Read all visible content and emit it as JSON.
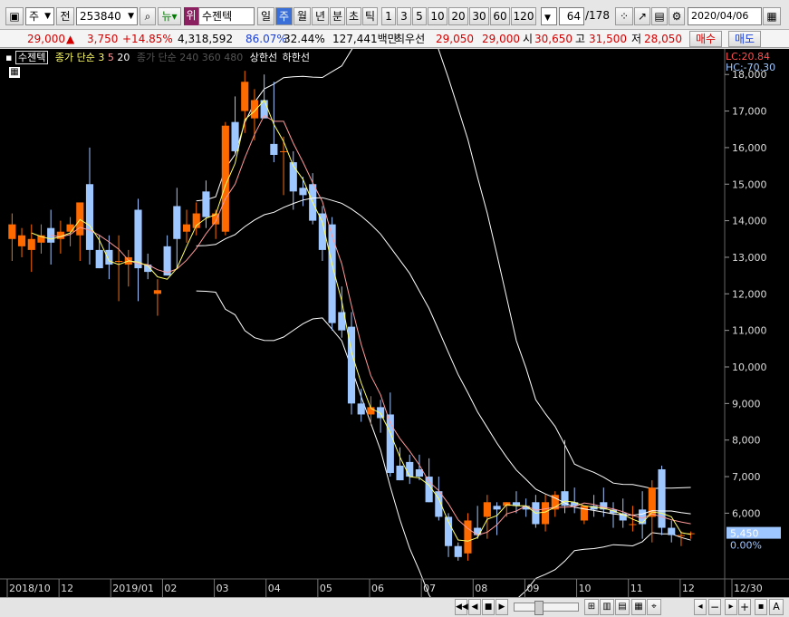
{
  "toolbar": {
    "period_label": "주",
    "jeon_label": "전",
    "code": "253840",
    "news_label": "뉴",
    "wi_label": "위",
    "stock_name": "수젠텍",
    "period_tabs": [
      "일",
      "주",
      "월",
      "년"
    ],
    "active_tab": "주",
    "time_units": [
      "분",
      "초",
      "틱"
    ],
    "intervals": [
      "1",
      "3",
      "5",
      "10",
      "20",
      "30",
      "60",
      "120"
    ],
    "page_current": "64",
    "page_total": "/178",
    "date": "2020/04/06"
  },
  "quote": {
    "price": "29,000",
    "change_arrow": "▲",
    "change": "3,750",
    "change_pct": "+14.85%",
    "volume": "4,318,592",
    "ratio1": "86.07%",
    "ratio2": "32.44%",
    "amount": "127,441백만",
    "best_ask_label": "최우선",
    "best_ask": "29,050",
    "best_bid": "29,000",
    "open_label": "시",
    "open": "30,650",
    "high_label": "고",
    "high": "31,500",
    "low_label": "저",
    "low": "28,050",
    "buy_label": "매수",
    "sell_label": "매도"
  },
  "chart_header": {
    "name": "수젠텍",
    "ma_label": "종가 단순",
    "ma_periods": [
      "3",
      "5",
      "20"
    ],
    "extra": "종가 단순 240 360 480",
    "upper_limit_label": "상한선",
    "lower_limit_label": "하한선",
    "lc_label": "LC:20.84",
    "hc_label": "HC:-70.30"
  },
  "chart_data": {
    "type": "candlestick",
    "y_range": [
      4300,
      18600
    ],
    "y_ticks": [
      "18,000",
      "17,000",
      "16,000",
      "15,000",
      "14,000",
      "13,000",
      "12,000",
      "11,000",
      "10,000",
      "9,000",
      "8,000",
      "7,000",
      "6,000"
    ],
    "last_price_label": "5,450",
    "last_pct_label": "0.00%",
    "x_labels": [
      "2018/10",
      "12",
      "2019/01",
      "02",
      "03",
      "04",
      "05",
      "06",
      "07",
      "08",
      "09",
      "10",
      "11",
      "12",
      "12/30"
    ],
    "candles": [
      {
        "o": 13500,
        "h": 14200,
        "l": 12900,
        "c": 13900
      },
      {
        "o": 13300,
        "h": 13800,
        "l": 13000,
        "c": 13600
      },
      {
        "o": 13200,
        "h": 13900,
        "l": 12600,
        "c": 13500
      },
      {
        "o": 13400,
        "h": 13900,
        "l": 13100,
        "c": 13600
      },
      {
        "o": 13800,
        "h": 14300,
        "l": 12800,
        "c": 13400
      },
      {
        "o": 13500,
        "h": 14000,
        "l": 13100,
        "c": 13700
      },
      {
        "o": 13700,
        "h": 14100,
        "l": 13300,
        "c": 13900
      },
      {
        "o": 13600,
        "h": 14400,
        "l": 12900,
        "c": 14500
      },
      {
        "o": 15000,
        "h": 16000,
        "l": 12800,
        "c": 13200
      },
      {
        "o": 13200,
        "h": 13600,
        "l": 12700,
        "c": 12700
      },
      {
        "o": 13200,
        "h": 13600,
        "l": 12400,
        "c": 12800
      },
      {
        "o": 12900,
        "h": 13600,
        "l": 11800,
        "c": 12900
      },
      {
        "o": 12800,
        "h": 13200,
        "l": 12200,
        "c": 13000
      },
      {
        "o": 14300,
        "h": 14600,
        "l": 11800,
        "c": 12700
      },
      {
        "o": 12800,
        "h": 13100,
        "l": 12400,
        "c": 12600
      },
      {
        "o": 12000,
        "h": 12400,
        "l": 11400,
        "c": 12100
      },
      {
        "o": 13300,
        "h": 13600,
        "l": 12500,
        "c": 12500
      },
      {
        "o": 14400,
        "h": 14900,
        "l": 12700,
        "c": 13500
      },
      {
        "o": 13700,
        "h": 14300,
        "l": 13400,
        "c": 13900
      },
      {
        "o": 13800,
        "h": 14500,
        "l": 13600,
        "c": 14200
      },
      {
        "o": 14800,
        "h": 15100,
        "l": 13800,
        "c": 14100
      },
      {
        "o": 13900,
        "h": 14300,
        "l": 13500,
        "c": 14200
      },
      {
        "o": 13700,
        "h": 16700,
        "l": 13600,
        "c": 16600
      },
      {
        "o": 16700,
        "h": 17400,
        "l": 15800,
        "c": 15900
      },
      {
        "o": 17000,
        "h": 18100,
        "l": 16400,
        "c": 17800
      },
      {
        "o": 16800,
        "h": 17600,
        "l": 16200,
        "c": 17300
      },
      {
        "o": 17300,
        "h": 18000,
        "l": 16800,
        "c": 16800
      },
      {
        "o": 16100,
        "h": 17800,
        "l": 15600,
        "c": 15800
      },
      {
        "o": 15900,
        "h": 16300,
        "l": 14700,
        "c": 15900
      },
      {
        "o": 15600,
        "h": 15900,
        "l": 14300,
        "c": 14800
      },
      {
        "o": 14900,
        "h": 15200,
        "l": 14400,
        "c": 14700
      },
      {
        "o": 15000,
        "h": 15300,
        "l": 13900,
        "c": 14000
      },
      {
        "o": 14200,
        "h": 14400,
        "l": 12900,
        "c": 13200
      },
      {
        "o": 13900,
        "h": 14100,
        "l": 11000,
        "c": 11200
      },
      {
        "o": 11500,
        "h": 12200,
        "l": 10800,
        "c": 11000
      },
      {
        "o": 11100,
        "h": 11500,
        "l": 8700,
        "c": 9000
      },
      {
        "o": 9000,
        "h": 9400,
        "l": 8500,
        "c": 8700
      },
      {
        "o": 8700,
        "h": 9200,
        "l": 8400,
        "c": 8900
      },
      {
        "o": 8900,
        "h": 9100,
        "l": 8200,
        "c": 8600
      },
      {
        "o": 8700,
        "h": 9300,
        "l": 7000,
        "c": 7100
      },
      {
        "o": 7300,
        "h": 7800,
        "l": 6900,
        "c": 6900
      },
      {
        "o": 7400,
        "h": 7600,
        "l": 6800,
        "c": 7000
      },
      {
        "o": 7200,
        "h": 7600,
        "l": 6900,
        "c": 7000
      },
      {
        "o": 7000,
        "h": 7500,
        "l": 6300,
        "c": 6300
      },
      {
        "o": 6600,
        "h": 7000,
        "l": 5800,
        "c": 5900
      },
      {
        "o": 5900,
        "h": 6000,
        "l": 4800,
        "c": 5100
      },
      {
        "o": 5100,
        "h": 5200,
        "l": 4700,
        "c": 4800
      },
      {
        "o": 4900,
        "h": 6000,
        "l": 4700,
        "c": 5800
      },
      {
        "o": 5600,
        "h": 6200,
        "l": 5300,
        "c": 5400
      },
      {
        "o": 5900,
        "h": 6500,
        "l": 5300,
        "c": 6300
      },
      {
        "o": 6200,
        "h": 6300,
        "l": 5400,
        "c": 6100
      },
      {
        "o": 6200,
        "h": 6300,
        "l": 5900,
        "c": 6300
      },
      {
        "o": 6300,
        "h": 6600,
        "l": 6000,
        "c": 6200
      },
      {
        "o": 6200,
        "h": 6400,
        "l": 5900,
        "c": 6100
      },
      {
        "o": 6300,
        "h": 6500,
        "l": 5600,
        "c": 5700
      },
      {
        "o": 5700,
        "h": 6500,
        "l": 5500,
        "c": 6300
      },
      {
        "o": 6100,
        "h": 6600,
        "l": 5900,
        "c": 6500
      },
      {
        "o": 6600,
        "h": 8000,
        "l": 6000,
        "c": 6200
      },
      {
        "o": 6300,
        "h": 6700,
        "l": 6000,
        "c": 6200
      },
      {
        "o": 5800,
        "h": 6200,
        "l": 5700,
        "c": 6200
      },
      {
        "o": 6200,
        "h": 6500,
        "l": 5900,
        "c": 6100
      },
      {
        "o": 6300,
        "h": 6700,
        "l": 5900,
        "c": 6100
      },
      {
        "o": 6100,
        "h": 6300,
        "l": 5600,
        "c": 6000
      },
      {
        "o": 6000,
        "h": 6400,
        "l": 5600,
        "c": 5800
      },
      {
        "o": 5700,
        "h": 6200,
        "l": 5500,
        "c": 5700
      },
      {
        "o": 6100,
        "h": 6600,
        "l": 5300,
        "c": 5700
      },
      {
        "o": 5900,
        "h": 6900,
        "l": 5200,
        "c": 6700
      },
      {
        "o": 7200,
        "h": 7300,
        "l": 5400,
        "c": 5600
      },
      {
        "o": 5600,
        "h": 5800,
        "l": 5200,
        "c": 5400
      },
      {
        "o": 5400,
        "h": 5500,
        "l": 5100,
        "c": 5400
      },
      {
        "o": 5450,
        "h": 5500,
        "l": 5300,
        "c": 5450
      }
    ],
    "ma_colors": {
      "ma3": "#ffff66",
      "ma5": "#ff9999",
      "ma20": "#ffffff"
    }
  },
  "colors": {
    "up": "#ff6a00",
    "down": "#9ec6ff",
    "background": "#000000",
    "grid": "#333333"
  }
}
